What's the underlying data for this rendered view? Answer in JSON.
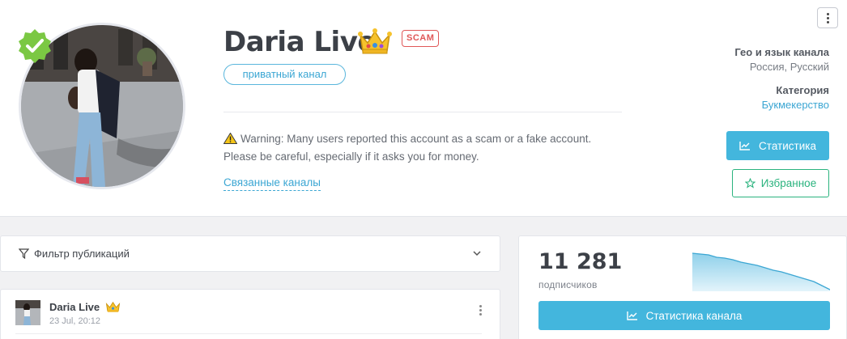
{
  "channel": {
    "title": "Daria Live",
    "scam_badge": "SCAM",
    "private_label": "приватный канал",
    "warning_text": "Warning: Many users reported this account as a scam or a fake account. Please be careful, especially if it asks you for money.",
    "related_link": "Связанные каналы"
  },
  "sidebar_info": {
    "geo_label": "Гео и язык канала",
    "geo_value": "Россия, Русский",
    "category_label": "Категория",
    "category_value": "Букмекерство"
  },
  "actions": {
    "stats_button": "Статистика",
    "favorite_button": "Избранное"
  },
  "filter": {
    "label": "Фильтр публикаций"
  },
  "post": {
    "author": "Daria Live",
    "date": "23 Jul, 20:12"
  },
  "stats_card": {
    "subscribers": "11 281",
    "subscribers_label": "подписчиков",
    "channel_stats_button": "Статистика канала"
  },
  "colors": {
    "accent_blue": "#43b6dd",
    "favorite_green": "#2ab37e",
    "scam_red": "#e05858",
    "verified_green": "#7bc843"
  },
  "icons": {
    "verified": "verified-badge-icon",
    "crown": "crown-icon",
    "warning": "warning-icon",
    "chart": "chart-line-icon",
    "star": "star-icon",
    "filter": "filter-icon",
    "chevron": "chevron-down-icon",
    "menu": "kebab-menu-icon"
  }
}
